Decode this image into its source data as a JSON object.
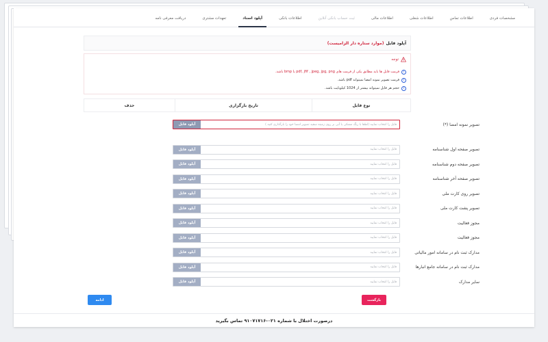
{
  "tabs": [
    {
      "label": "مشخصات فردی",
      "state": "normal"
    },
    {
      "label": "اطلاعات تماس",
      "state": "normal"
    },
    {
      "label": "اطلاعات شغلی",
      "state": "normal"
    },
    {
      "label": "اطلاعات مالی",
      "state": "normal"
    },
    {
      "label": "ثبت حساب بانکی آنلاین",
      "state": "disabled"
    },
    {
      "label": "اطلاعات بانکی",
      "state": "normal"
    },
    {
      "label": "آپلود اسناد",
      "state": "active"
    },
    {
      "label": "تعهدات مشتری",
      "state": "normal"
    },
    {
      "label": "دریافت معرفی نامه",
      "state": "normal"
    }
  ],
  "panel": {
    "title": "آپلود فایل",
    "title_required": "(موارد ستاره دار الزامیست)"
  },
  "notice": {
    "heading": "توجه",
    "items": [
      {
        "text": "فرمت فایل ها باید مطابق یکی از فرمت های pdf, jfif , jpeg, jpg, png یا bmp باشد."
      },
      {
        "text": "فرمت تصویر نمونه امضا نمیتواند pdf باشد."
      },
      {
        "text": "حجم هر فایل نمیتواند بیشتر از 1024 کیلوبایت باشد."
      }
    ]
  },
  "columns": {
    "type": "نوع فایل",
    "date": "تاریخ بارگزاری",
    "delete": "حذف"
  },
  "signature": {
    "label": "تصویر نمونه امضا (*)",
    "placeholder": "فایل را انتخاب نمایید (لطفا با رنگ مشکی یا آبی بر روی زمینه سفید تصویر امضا خود را بارگذاری کنید )",
    "button": "آپلود فایل"
  },
  "uploads": [
    {
      "label": "تصویر صفحه اول شناسنامه",
      "placeholder": "فایل را انتخاب نمایید",
      "button": "آپلود فایل"
    },
    {
      "label": "تصویر صفحه دوم شناسنامه",
      "placeholder": "فایل را انتخاب نمایید",
      "button": "آپلود فایل"
    },
    {
      "label": "تصویر صفحه آخر شناسنامه",
      "placeholder": "فایل را انتخاب نمایید",
      "button": "آپلود فایل"
    },
    {
      "label": "تصویر روی کارت ملی",
      "placeholder": "فایل را انتخاب نمایید",
      "button": "آپلود فایل"
    },
    {
      "label": "تصویر پشت کارت ملی",
      "placeholder": "فایل را انتخاب نمایید",
      "button": "آپلود فایل"
    },
    {
      "label": "مجوز فعالیت",
      "placeholder": "فایل را انتخاب نمایید",
      "button": "آپلود فایل"
    },
    {
      "label": "مجوز فعالیت",
      "placeholder": "فایل را انتخاب نمایید",
      "button": "آپلود فایل"
    },
    {
      "label": "مدارک ثبت نام در سامانه امور مالیاتی",
      "placeholder": "فایل را انتخاب نمایید",
      "button": "آپلود فایل"
    },
    {
      "label": "مدارک ثبت نام در سامانه جامع انبارها",
      "placeholder": "فایل را انتخاب نمایید",
      "button": "آپلود فایل"
    },
    {
      "label": "سایر مدارک",
      "placeholder": "فایل را انتخاب نمایید",
      "button": "آپلود فایل"
    }
  ],
  "actions": {
    "back": "بازگشت",
    "submit": "ادامه"
  },
  "footer": {
    "text": "درصورت اختلال با شماره ۰۲۱-۹۱۰۷۱۷۱۶ تماس بگیرید"
  },
  "colors": {
    "accent_red": "#d1243b",
    "upload_button": "#a3aec4",
    "back_button": "#e8245c",
    "submit_button": "#2f8af0"
  }
}
